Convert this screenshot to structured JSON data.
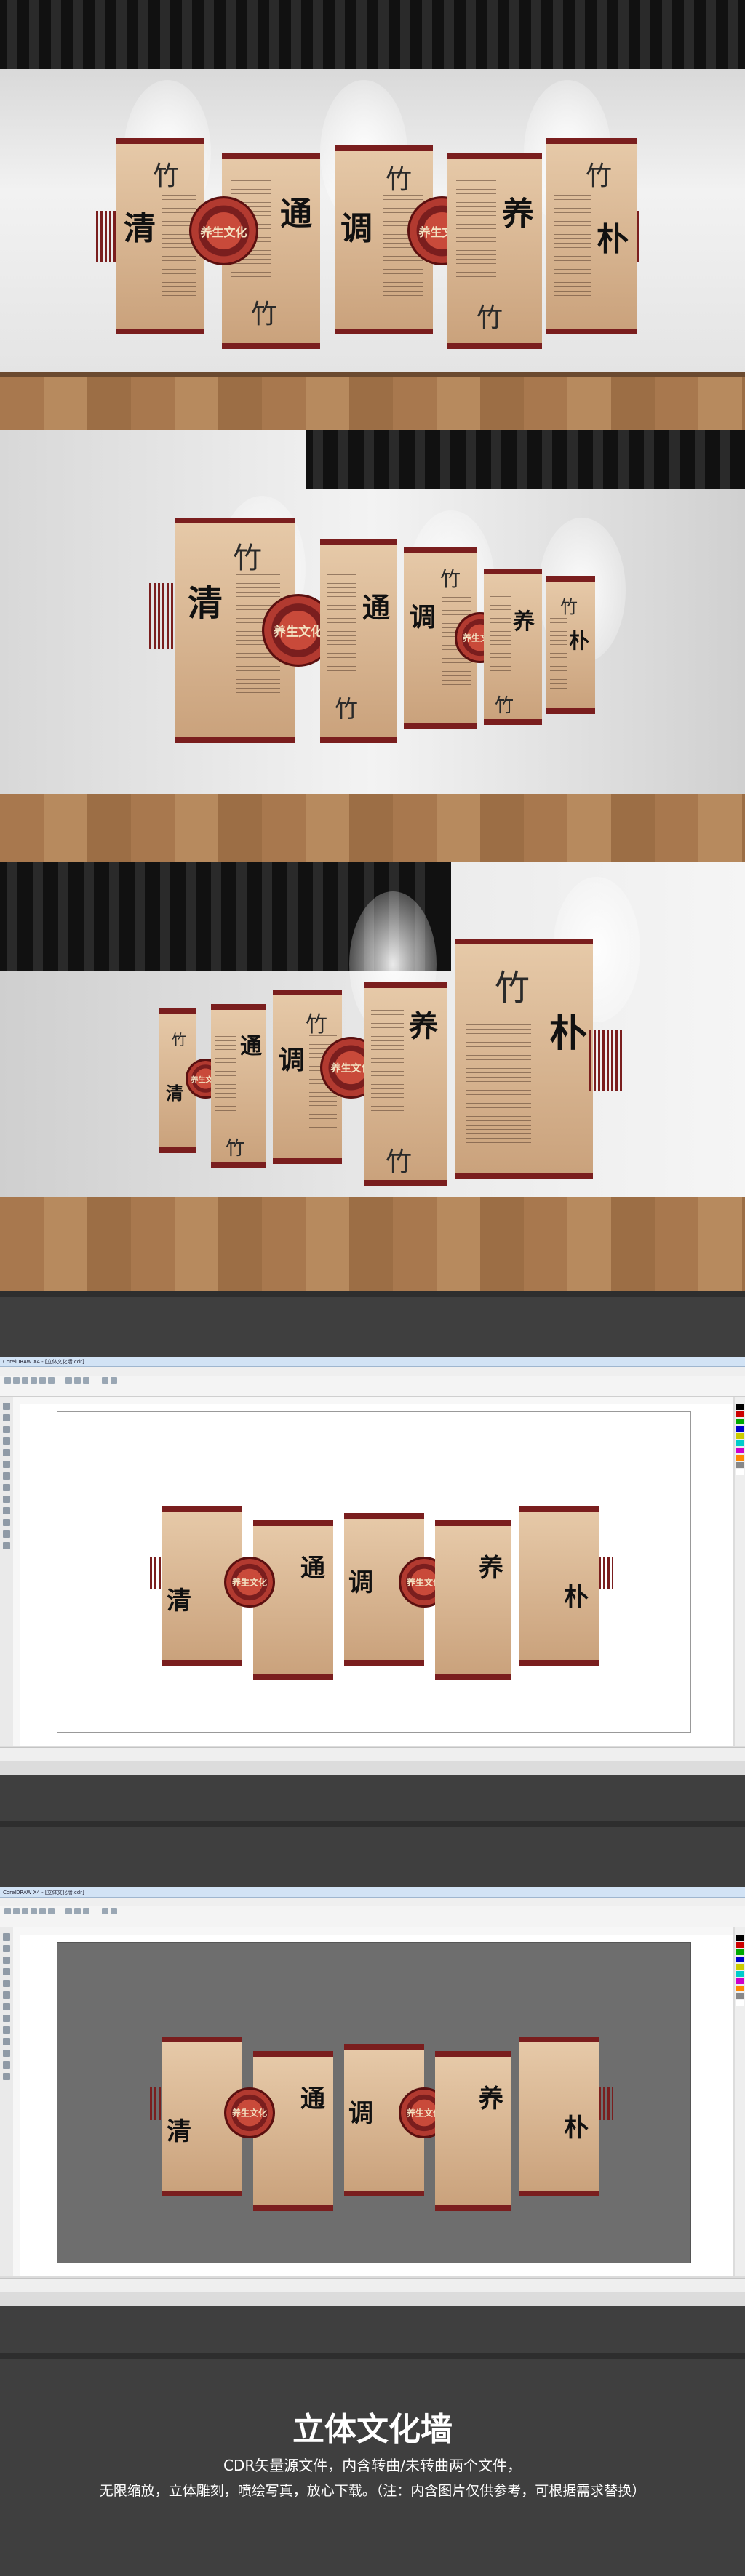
{
  "wall_characters": [
    "清",
    "通",
    "调",
    "养",
    "朴"
  ],
  "medallion_text": "养生文化",
  "medallion_glyph": "回",
  "bamboo_icon_name": "bamboo-icon",
  "brand_colors": {
    "maroon": "#7a1e1e",
    "tan": "#d6b28c",
    "gray_bg": "#3f3f3f"
  },
  "software": {
    "window_title_1": "CorelDRAW X4 - [立体文化墙.cdr]",
    "window_title_2": "CorelDRAW X4 - [立体文化墙.cdr]"
  },
  "footer": {
    "title": "立体文化墙",
    "line1": "CDR矢量源文件，内含转曲/未转曲两个文件，",
    "line2": "无限缩放，立体雕刻，喷绘写真，放心下载。（注：内含图片仅供参考，可根据需求替换）"
  }
}
